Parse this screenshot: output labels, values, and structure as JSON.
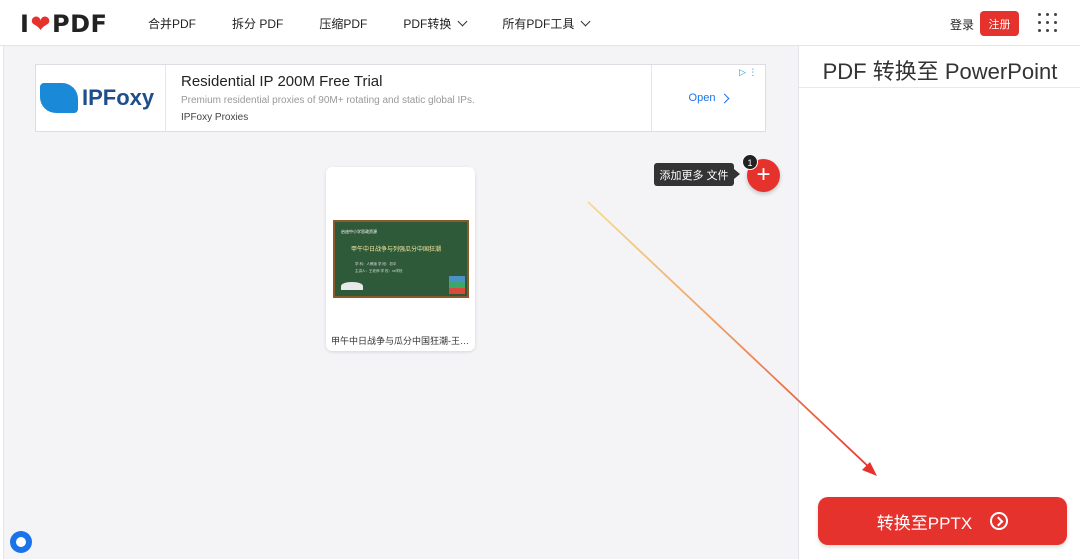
{
  "header": {
    "logo": {
      "left": "I",
      "right": "PDF"
    },
    "nav": [
      {
        "label": "合并PDF",
        "dropdown": false
      },
      {
        "label": "拆分 PDF",
        "dropdown": false
      },
      {
        "label": "压缩PDF",
        "dropdown": false
      },
      {
        "label": "PDF转换",
        "dropdown": true
      },
      {
        "label": "所有PDF工具",
        "dropdown": true
      }
    ],
    "login": "登录",
    "signup": "注册"
  },
  "ad": {
    "brand": "IPFoxy",
    "title": "Residential IP 200M Free Trial",
    "description": "Premium residential proxies of 90M+ rotating and static global IPs.",
    "source": "IPFoxy Proxies",
    "cta": "Open"
  },
  "workspace": {
    "file": {
      "name": "甲午中日战争与瓜分中国狂潮-王…",
      "thumb_header": "启迪中小学思政资源",
      "thumb_title": "甲午中日战争与列强瓜分中国狂潮",
      "thumb_line1": "学 科：人教版    学 段：初中",
      "thumb_line2": "主讲人：王老师    学 校：xx学校"
    },
    "add_more_tooltip": "添加更多 文件",
    "file_count": "1"
  },
  "sidebar": {
    "title": "PDF 转换至 PowerPoint",
    "convert_button": "转换至PPTX"
  },
  "colors": {
    "brand_red": "#e5322d",
    "arrow": "#e5322d"
  }
}
